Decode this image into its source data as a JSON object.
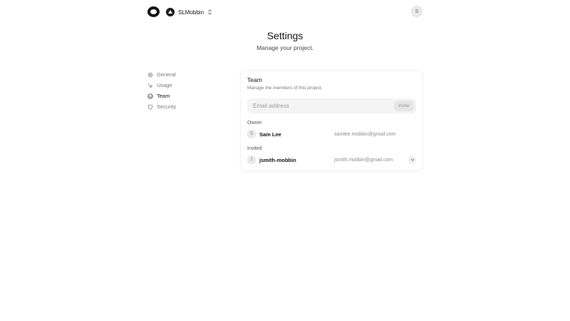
{
  "header": {
    "project_name": "SLMobbin",
    "user_initial": "S"
  },
  "page": {
    "title": "Settings",
    "subtitle": "Manage your project."
  },
  "sidebar": {
    "items": [
      {
        "label": "General",
        "icon": "gear-icon",
        "active": false
      },
      {
        "label": "Usage",
        "icon": "usage-icon",
        "active": false
      },
      {
        "label": "Team",
        "icon": "smiley-icon",
        "active": true
      },
      {
        "label": "Security",
        "icon": "shield-icon",
        "active": false
      }
    ]
  },
  "team": {
    "title": "Team",
    "description": "Manage the members of this project.",
    "email_placeholder": "Email address",
    "email_value": "",
    "invite_label": "Invite",
    "owner_label": "Owner",
    "owner": {
      "initial": "S",
      "name": "Sam Lee",
      "email": "samlee.mobbin@gmail.com"
    },
    "invited_label": "Invited",
    "invited": [
      {
        "initial": "J",
        "name": "jsmith-mobbin",
        "email": "jsmith.mobbin@gmail.com"
      }
    ]
  },
  "colors": {
    "text_primary": "#111111",
    "text_muted": "#777777",
    "input_bg": "#f4f4f4",
    "avatar_bg": "#ececec"
  }
}
